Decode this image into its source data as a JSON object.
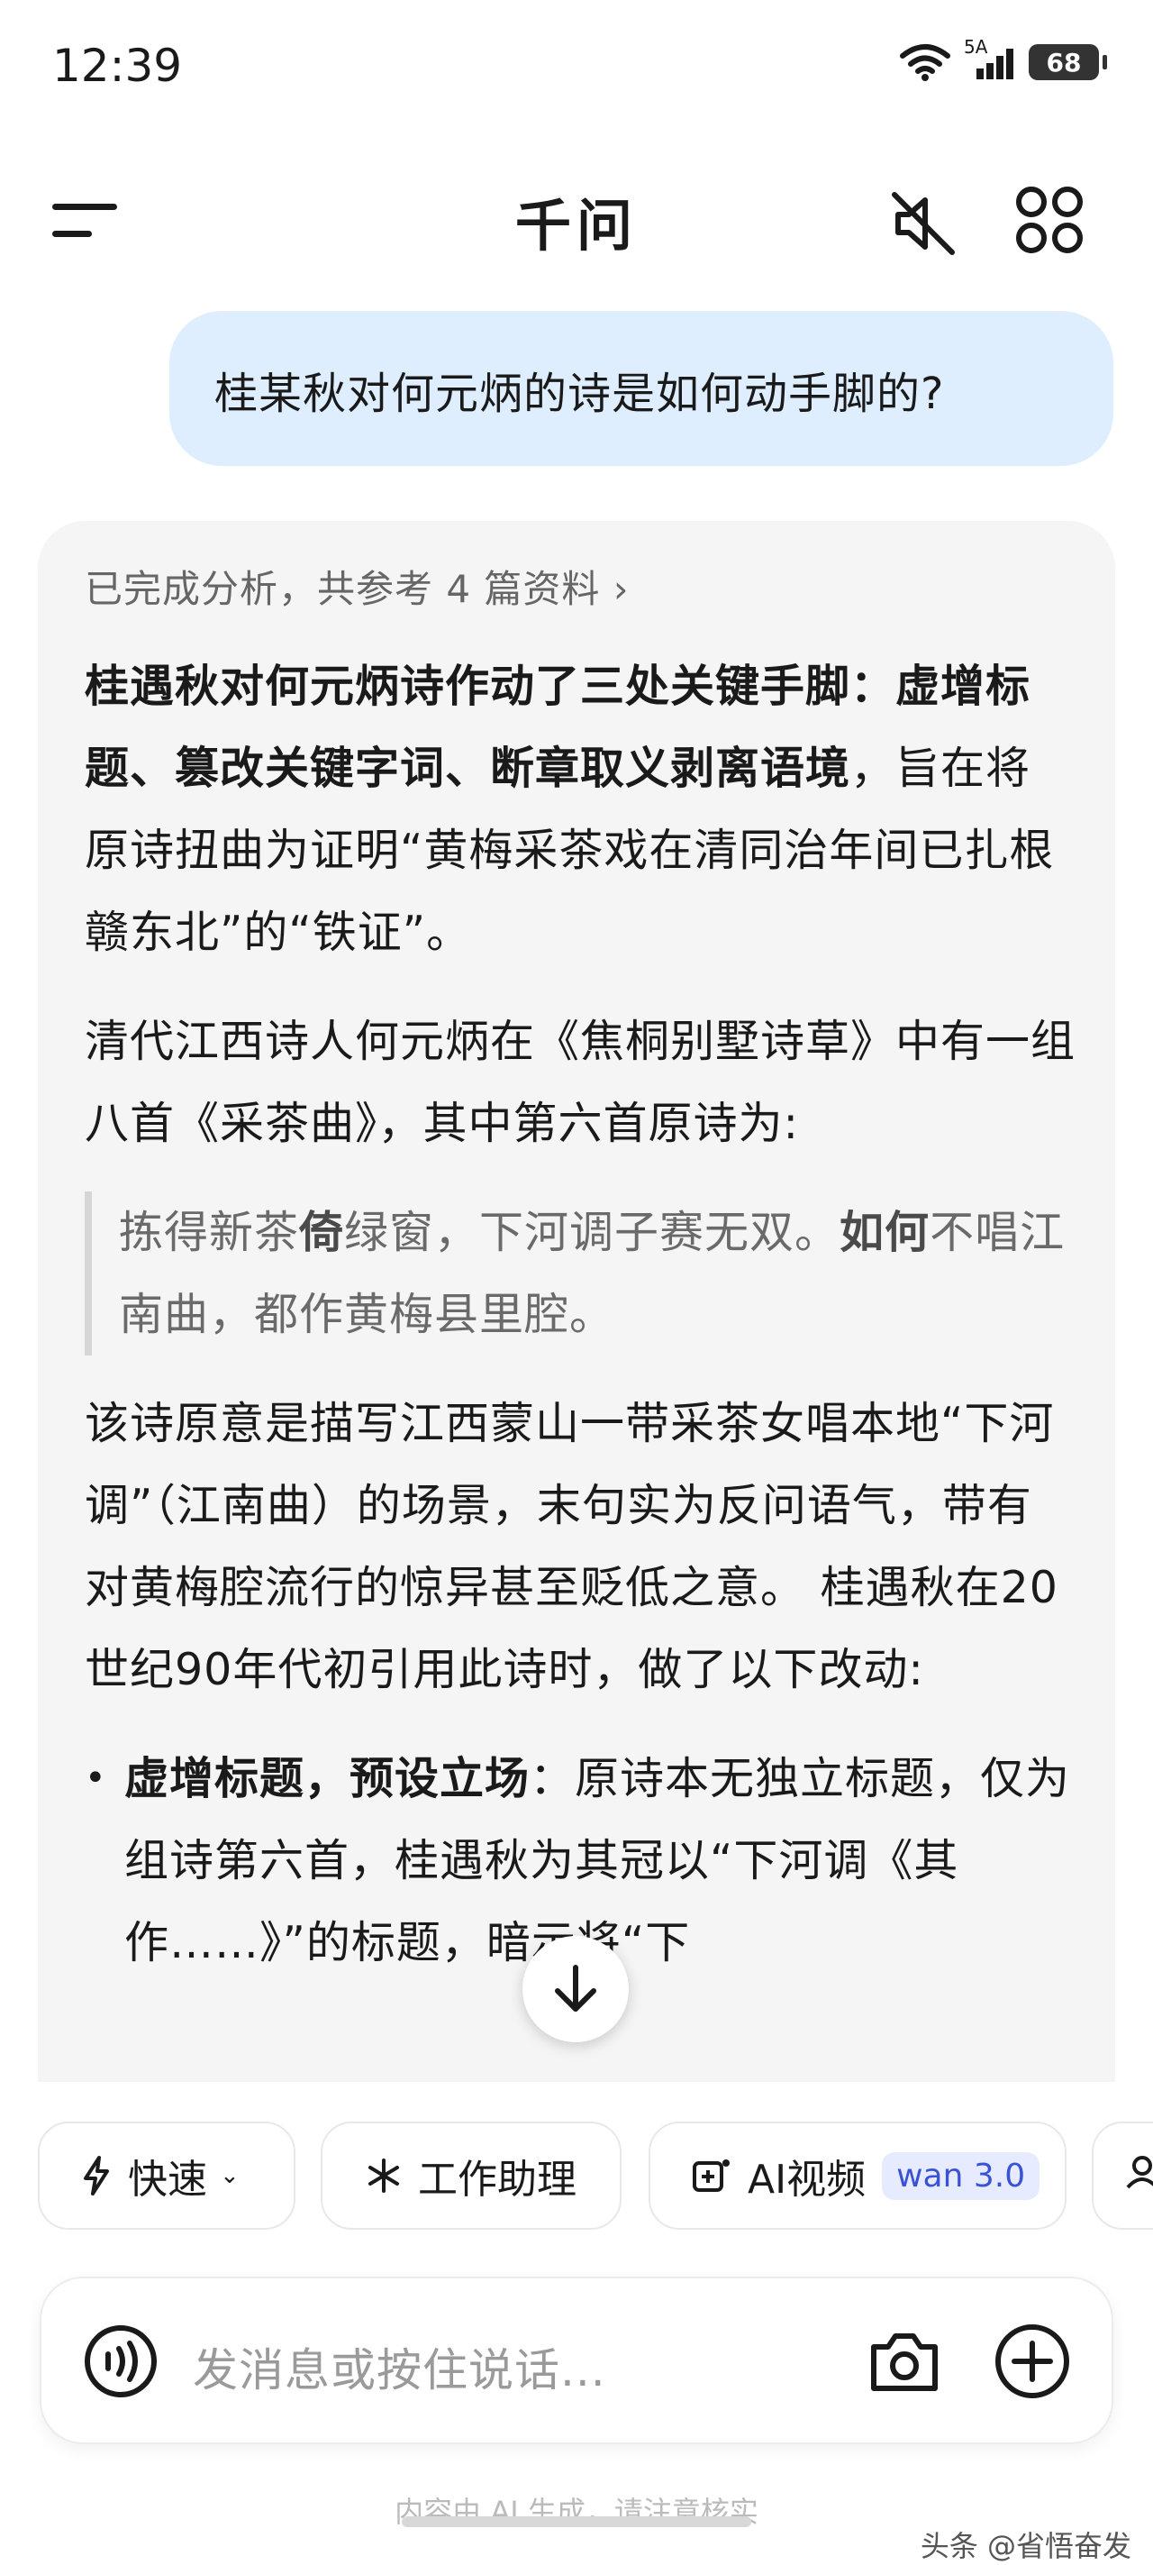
{
  "status": {
    "time": "12:39",
    "network": "5A",
    "battery": "68"
  },
  "header": {
    "title": "千问"
  },
  "chat": {
    "user_message": "桂某秋对何元炳的诗是如何动手脚的?",
    "answer": {
      "references": "已完成分析，共参考 4 篇资料 ›",
      "para1_bold": "桂遇秋对何元炳诗作动了三处关键手脚：虚增标题、篡改关键字词、断章取义剥离语境",
      "para1_rest": "，旨在将原诗扭曲为证明“黄梅采茶戏在清同治年间已扎根赣东北”的“铁证”。",
      "para2": "清代江西诗人何元炳在《焦桐别墅诗草》中有一组八首《采茶曲》，其中第六首原诗为:",
      "quote_part1": "拣得新茶",
      "quote_bold1": "倚",
      "quote_part2": "绿窗，下河调子赛无双。",
      "quote_bold2": "如何",
      "quote_part3": "不唱江南曲，都作黄梅县里腔。",
      "para3": "该诗原意是描写江西蒙山一带采茶女唱本地“下河调”（江南曲）的场景，末句实为反问语气，带有对黄梅腔流行的惊异甚至贬低之意。 桂遇秋在20世纪90年代初引用此诗时，做了以下改动:",
      "bullet1_bold": "虚增标题，预设立场",
      "bullet1_rest": "：原诗本无独立标题，仅为组诗第六首，桂遇秋为其冠以“下河调《其作……》”的标题，暗示将“下"
    }
  },
  "chips": [
    {
      "label": "快速",
      "icon": "lightning-icon"
    },
    {
      "label": "工作助理",
      "icon": "sparkle-icon"
    },
    {
      "label": "AI视频",
      "icon": "video-plus-icon",
      "badge": "wan 3.0"
    }
  ],
  "input": {
    "placeholder": "发消息或按住说话..."
  },
  "footer": {
    "disclaimer": "内容由 AI 生成，请注意核实",
    "watermark": "头条 @省悟奋发"
  }
}
